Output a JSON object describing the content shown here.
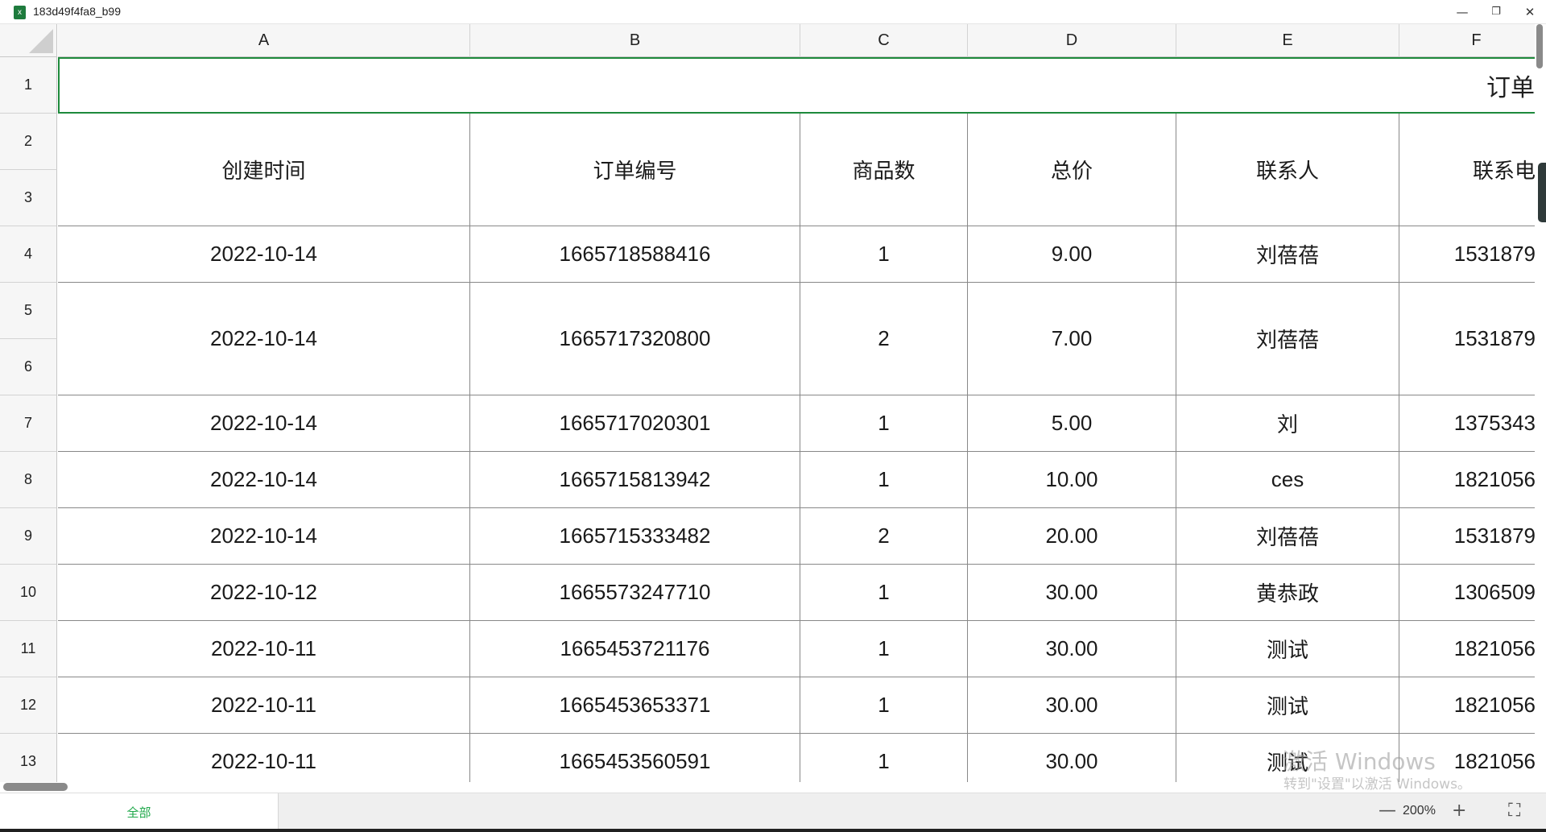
{
  "window": {
    "title": "183d49f4fa8_b99",
    "app_icon": "x",
    "buttons": {
      "minimize": "—",
      "restore": "❐",
      "close": "✕"
    }
  },
  "sheet": {
    "columns": [
      "A",
      "B",
      "C",
      "D",
      "E",
      "F"
    ],
    "rows": [
      "1",
      "2",
      "3",
      "4",
      "5",
      "6",
      "7",
      "8",
      "9",
      "10",
      "11",
      "12",
      "13"
    ],
    "title_text": "订单",
    "headers": [
      "创建时间",
      "订单编号",
      "商品数",
      "总价",
      "联系人",
      "联系电"
    ],
    "records": [
      [
        "2022-10-14",
        "1665718588416",
        "1",
        "9.00",
        "刘蓓蓓",
        "1531879"
      ],
      [
        "2022-10-14",
        "1665717320800",
        "2",
        "7.00",
        "刘蓓蓓",
        "1531879"
      ],
      [
        "2022-10-14",
        "1665717020301",
        "1",
        "5.00",
        "刘",
        "1375343"
      ],
      [
        "2022-10-14",
        "1665715813942",
        "1",
        "10.00",
        "ces",
        "1821056"
      ],
      [
        "2022-10-14",
        "1665715333482",
        "2",
        "20.00",
        "刘蓓蓓",
        "1531879"
      ],
      [
        "2022-10-12",
        "1665573247710",
        "1",
        "30.00",
        "黄恭政",
        "1306509"
      ],
      [
        "2022-10-11",
        "1665453721176",
        "1",
        "30.00",
        "测试",
        "1821056"
      ],
      [
        "2022-10-11",
        "1665453653371",
        "1",
        "30.00",
        "测试",
        "1821056"
      ],
      [
        "2022-10-11",
        "1665453560591",
        "1",
        "30.00",
        "测试",
        "1821056"
      ]
    ]
  },
  "bottombar": {
    "sheet_tab": "全部",
    "zoom": "200%",
    "zoom_out": "—",
    "zoom_in": "+",
    "fullscreen": "⛶"
  },
  "watermark": {
    "line1": "激活 Windows",
    "line2": "转到\"设置\"以激活 Windows。"
  }
}
